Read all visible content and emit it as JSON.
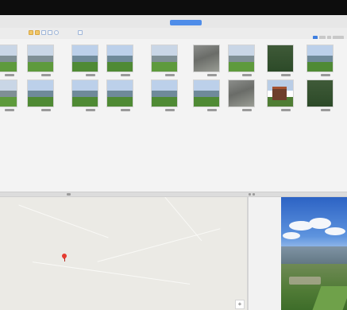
{
  "window": {
    "title": "",
    "mode_badge": ""
  },
  "toolbar": {
    "label": "",
    "icons": [
      "folder-icon",
      "folder-icon",
      "copy-icon",
      "refresh-icon",
      "link-icon"
    ]
  },
  "view_controls": [
    "grid-view-icon",
    "list-view-icon",
    "edit-icon"
  ],
  "thumbnails": {
    "row1": [
      {
        "kind": "meadow",
        "caption": ""
      },
      {
        "kind": "meadow",
        "caption": ""
      },
      {
        "kind": "valley",
        "caption": ""
      },
      {
        "kind": "valley",
        "caption": ""
      },
      {
        "kind": "meadow",
        "caption": ""
      },
      {
        "kind": "rock",
        "caption": ""
      },
      {
        "kind": "meadow",
        "caption": ""
      },
      {
        "kind": "forest",
        "caption": ""
      },
      {
        "kind": "valley",
        "caption": ""
      }
    ],
    "row2": [
      {
        "kind": "meadow",
        "caption": ""
      },
      {
        "kind": "valley",
        "caption": ""
      },
      {
        "kind": "valley",
        "caption": ""
      },
      {
        "kind": "valley",
        "caption": ""
      },
      {
        "kind": "valley",
        "caption": ""
      },
      {
        "kind": "valley",
        "caption": ""
      },
      {
        "kind": "rock",
        "caption": ""
      },
      {
        "kind": "house",
        "caption": ""
      },
      {
        "kind": "forest",
        "caption": ""
      }
    ]
  },
  "map": {
    "place_label": "",
    "pin": "location-pin-icon",
    "zoom_in": "+"
  },
  "colors": {
    "accent": "#4f8de9",
    "pin": "#e53b30",
    "topbar": "#0d0d0d"
  }
}
